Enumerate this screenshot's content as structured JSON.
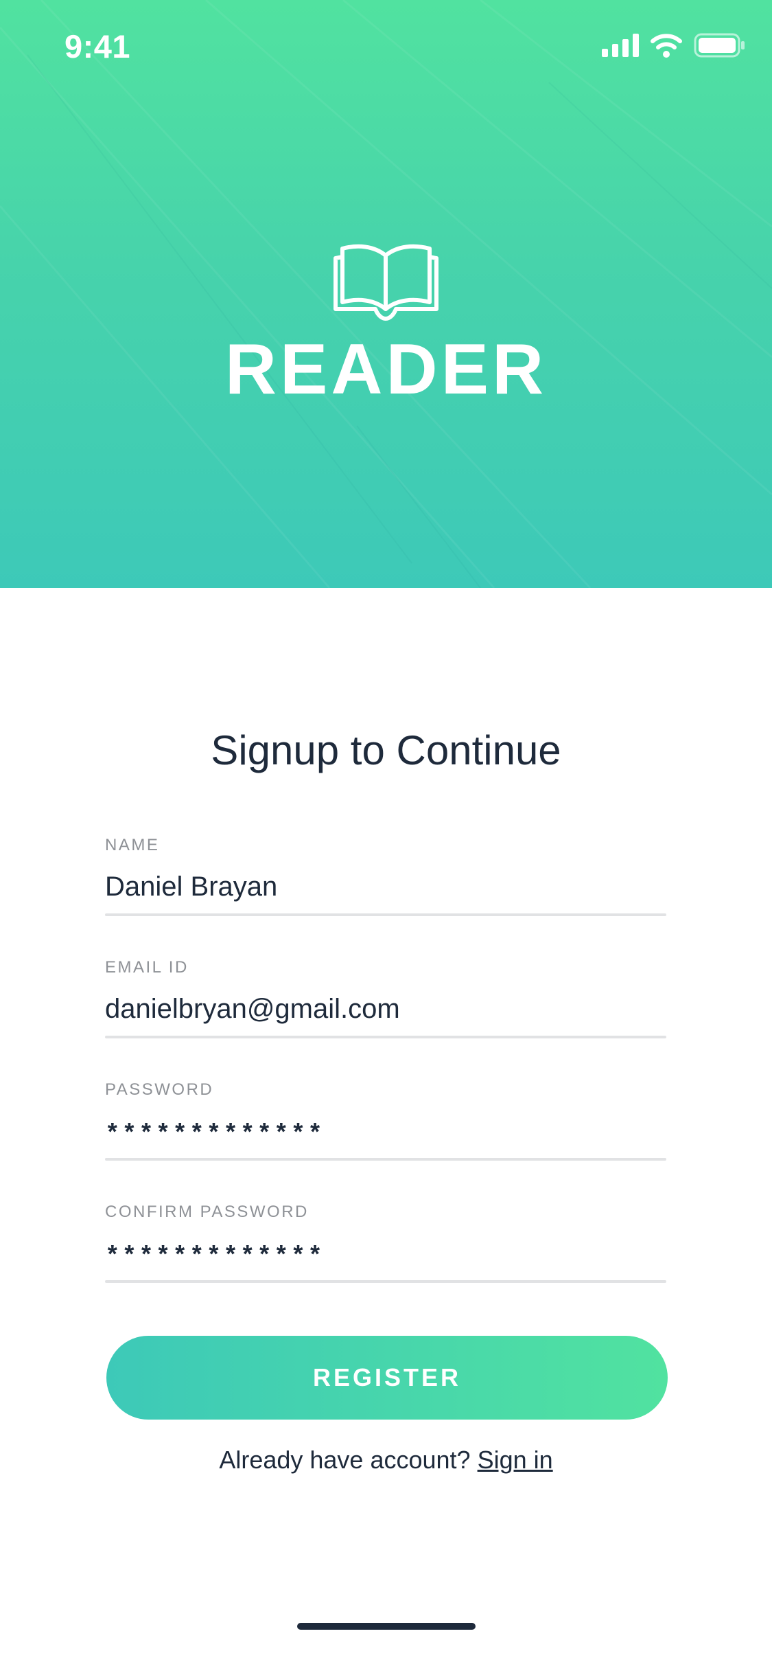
{
  "status_bar": {
    "time": "9:41",
    "icons": [
      "cellular-signal-icon",
      "wifi-icon",
      "battery-icon"
    ]
  },
  "hero": {
    "logo_icon": "open-book-icon",
    "brand_name": "READER",
    "gradient_top": "#51e2a0",
    "gradient_bottom": "#3dc9b8"
  },
  "form": {
    "title": "Signup to Continue",
    "fields": [
      {
        "label": "NAME",
        "value": "Daniel Brayan"
      },
      {
        "label": "EMAIL ID",
        "value": "danielbryan@gmail.com"
      },
      {
        "label": "PASSWORD",
        "value": "*************"
      },
      {
        "label": "CONFIRM PASSWORD",
        "value": "*************"
      }
    ],
    "register_label": "REGISTER"
  },
  "footer": {
    "prompt": "Already have account?",
    "signin_label": "Sign in"
  },
  "colors": {
    "text_dark": "#1e2a3b",
    "label_gray": "#8e9196",
    "divider": "#e1e2e4",
    "accent_start": "#3dc9b8",
    "accent_end": "#51e2a0"
  }
}
